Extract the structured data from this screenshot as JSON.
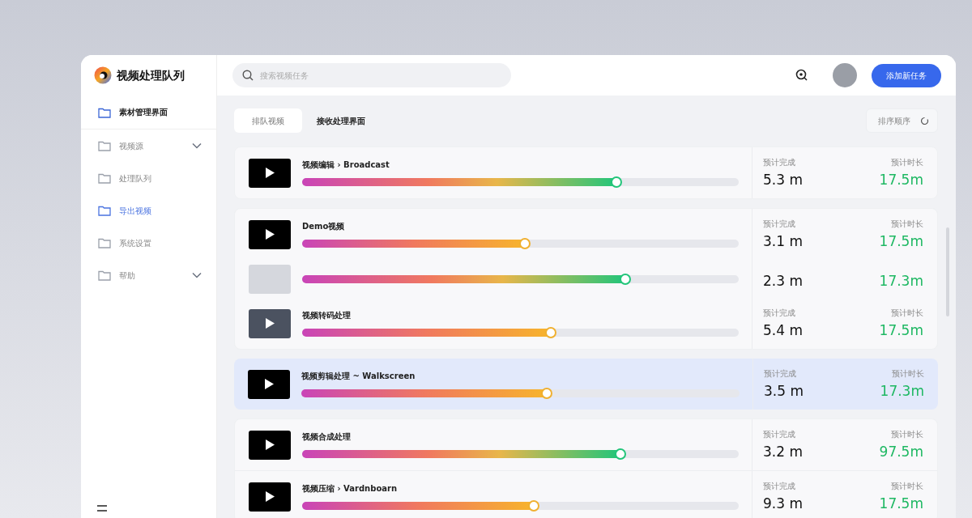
{
  "app": {
    "title": "视频处理队列"
  },
  "sidebar": {
    "items": [
      {
        "label": "素材管理界面",
        "kind": "header",
        "expandable": false,
        "selected": false
      },
      {
        "label": "视频源",
        "kind": "item",
        "expandable": true,
        "selected": false
      },
      {
        "label": "处理队列",
        "kind": "item",
        "expandable": false,
        "selected": false
      },
      {
        "label": "导出视频",
        "kind": "accent",
        "expandable": false,
        "selected": false
      },
      {
        "label": "系统设置",
        "kind": "item",
        "expandable": false,
        "selected": false
      },
      {
        "label": "帮助",
        "kind": "item",
        "expandable": true,
        "selected": false
      }
    ]
  },
  "search": {
    "placeholder": "搜索视频任务"
  },
  "header_button": "添加新任务",
  "tabs": [
    {
      "label": "排队视频",
      "selected": true
    },
    {
      "label": "接收处理界面",
      "selected": false
    }
  ],
  "sort_button": "排序顺序",
  "groups": [
    {
      "selected": false,
      "jobs": [
        {
          "title": "视频编辑 › Broadcast",
          "kind": "video",
          "level": 0.72,
          "label_a": "预计完成",
          "value_a": "5.3 m",
          "label_b": "预计时长",
          "value_b": "17.5m"
        }
      ]
    },
    {
      "selected": false,
      "jobs": [
        {
          "title": "Demo视频",
          "kind": "video",
          "level": 0.51,
          "label_a": "预计完成",
          "value_a": "3.1 m",
          "label_b": "预计时长",
          "value_b": "17.5m"
        },
        {
          "kind": "empty",
          "level": 0.74,
          "value_a": "2.3 m",
          "value_b": "17.3m"
        },
        {
          "title": "视频转码处理",
          "kind": "dim",
          "level": 0.57,
          "label_a": "预计完成",
          "value_a": "5.4 m",
          "label_b": "预计时长",
          "value_b": "17.5m"
        }
      ]
    },
    {
      "selected": true,
      "jobs": [
        {
          "title": "视频剪辑处理 ~ Walkscreen",
          "kind": "video",
          "level": 0.56,
          "label_a": "预计完成",
          "value_a": "3.5 m",
          "label_b": "预计时长",
          "value_b": "17.3m"
        }
      ]
    },
    {
      "selected": false,
      "jobs": [
        {
          "title": "视频合成处理",
          "kind": "video",
          "level": 0.73,
          "label_a": "预计完成",
          "value_a": "3.2 m",
          "label_b": "预计时长",
          "value_b": "97.5m"
        },
        {
          "title": "视频压缩 › Vardnboarn",
          "kind": "video",
          "level": 0.53,
          "label_a": "预计完成",
          "value_a": "9.3 m",
          "label_b": "预计时长",
          "value_b": "17.5m"
        }
      ]
    }
  ]
}
